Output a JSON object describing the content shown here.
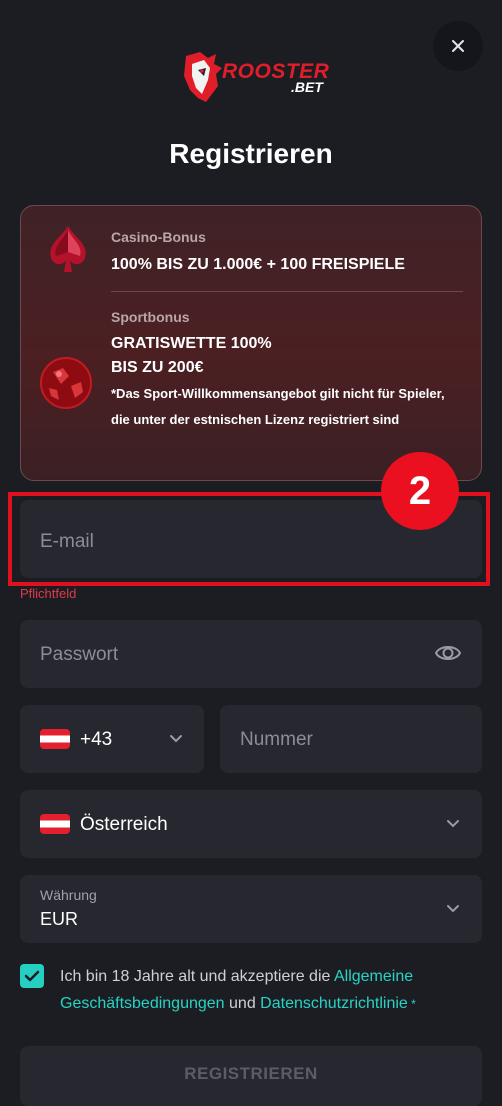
{
  "header": {
    "logo_text_main": "ROOSTER",
    "logo_text_sub": ".BET",
    "title": "Registrieren"
  },
  "bonus": {
    "casino_label": "Casino-Bonus",
    "casino_value": "100% BIS ZU 1.000€ + 100 FREISPIELE",
    "sport_label": "Sportbonus",
    "sport_value_line1": "GRATISWETTE 100%",
    "sport_value_line2": "BIS ZU 200€",
    "sport_note": "*Das Sport-Willkommensangebot gilt nicht für Spieler, die unter der estnischen Lizenz registriert sind"
  },
  "step_badge": "2",
  "form": {
    "email_placeholder": "E-mail",
    "email_error": "Pflichtfeld",
    "password_placeholder": "Passwort",
    "phone_code": "+43",
    "phone_placeholder": "Nummer",
    "country": "Österreich",
    "currency_label": "Währung",
    "currency_value": "EUR",
    "terms_prefix": "Ich bin 18 Jahre alt und akzeptiere die ",
    "terms_link1": "Allgemeine Geschäftsbedingungen",
    "terms_mid": " und ",
    "terms_link2": "Datenschutzrichtlinie",
    "terms_required": " *",
    "submit_label": "REGISTRIEREN"
  },
  "icons": [
    "close-icon",
    "rooster-logo-icon",
    "casino-gem-icon",
    "sport-ball-icon",
    "eye-icon",
    "chevron-down-icon",
    "austria-flag-icon",
    "check-icon"
  ],
  "colors": {
    "background": "#1c1d23",
    "field": "#26272f",
    "accent_teal": "#27d3c4",
    "highlight_red": "#e0101e",
    "brand_red": "#e01e2a"
  }
}
